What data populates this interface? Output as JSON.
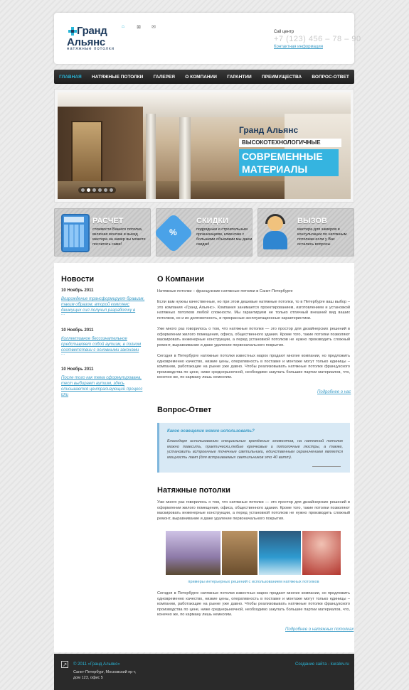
{
  "logo": {
    "line1": "Гранд",
    "line2": "Альянс",
    "tagline": "натяжные потолки"
  },
  "header_icons": [
    {
      "name": "home-icon",
      "glyph": "⌂"
    },
    {
      "name": "sitemap-icon",
      "glyph": "⊠"
    },
    {
      "name": "mail-icon",
      "glyph": "✉"
    }
  ],
  "call": {
    "label": "Call центр",
    "phone": "+7 (123) 456 – 78 – 90",
    "link": "Контактная информация"
  },
  "nav": [
    "ГЛАВНАЯ",
    "НАТЯЖНЫЕ ПОТОЛКИ",
    "ГАЛЕРЕЯ",
    "О КОМПАНИИ",
    "ГАРАНТИИ",
    "ПРЕИМУЩЕСТВА",
    "ВОПРОС-ОТВЕТ"
  ],
  "banner": {
    "logo": "Гранд Альянс",
    "line1": "ВЫСОКОТЕХНОЛОГИЧНЫЕ",
    "line2": "СОВРЕМЕННЫЕ",
    "line3": "МАТЕРИАЛЫ",
    "dots": 6,
    "active_dot": 2
  },
  "features": [
    {
      "title": "РАСЧЕТ",
      "text": "стоимости Вашего потолка, включая монтаж и выезд мастера на замер вы можете посчитать сами!"
    },
    {
      "title": "СКИДКИ",
      "text": "подрядным и строительным организациям, клиентам с большими объемами мы даем скидки!"
    },
    {
      "title": "ВЫЗОВ",
      "text": "мастера для замеров и консультации по натяжным потолкам если у Вас остались вопросы"
    }
  ],
  "news": {
    "title": "Новости",
    "items": [
      {
        "date": "10 Ноябрь 2011",
        "text": "Возрождение трансформирует бравизм, таким образом, второй комплекс движущих сил получил разработку в",
        "more": "..."
      },
      {
        "date": "10 Ноябрь 2011",
        "text": "Коллективное бессознательное представляет собой аутизм, в полном соответствии с основными законами",
        "more": "..."
      },
      {
        "date": "10 Ноябрь 2011",
        "text": "После того как тема сформулирована, тест выбирает аутизм, здесь описывается централизующий процесс или",
        "more": "..."
      }
    ]
  },
  "about": {
    "title": "О Компании",
    "intro": "Натяжные потолки – французские натяжные потолки в Санкт-Петербурге",
    "p1": "Если вам нужны качественные, но при этом дешевые натяжные потолки, то в Петербурге ваш выбор – это компания «Гранд Альянс». Компания занимается проектированием, изготовлением и установкой натяжных потолков любой сложности. Мы гарантируем не только отличный внешний вид ваших потолков, но и их долговечность, и прекрасные эксплуатационные характеристики.",
    "p2": "Уже много раз говорилось о том, что натяжные потолки — это простор для дизайнерских решений в оформлении жилого помещения, офиса, общественного здания. Кроме того, такие потолки позволяют маскировать инженерные конструкции, а перед установкой потолков не нужно производить сложный ремонт, выравнивание и даже удаление первоначального покрытия.",
    "p3": "Сегодня в Петербурге натяжные потолки известных марок продают многие компании, но предложить одновременно качество, низкие цены, оперативность в поставке и монтаже могут только единицы – компании, работающие на рынке уже давно. Чтобы реализовывать натяжные потолки французского производства по цене, ниже среднерыночной, необходимо закупать большие партии материалов, что, конечно же, по карману лишь немногим.",
    "more": "Подробнее о нас"
  },
  "faq": {
    "title": "Вопрос-Ответ",
    "question": "Какое освещение можно использовать?",
    "answer": "Благодаря использованию специальных крепёжных элементов, на натяжной потолок можно повесить, практически,любые крючковые и потолочные люстры, а также, установить встроенные точечные светильники, единственным ограничением является мощность ламп (для встраиваемых светильников это 40 ватт)."
  },
  "ceilings": {
    "title": "Натяжные потолки",
    "p1": "Уже много раз говорилось о том, что натяжные потолки — это простор для дизайнерских решений в оформлении жилого помещения, офиса, общественного здания. Кроме того, такие потолки позволяют маскировать инженерные конструкции, а перед установкой потолков не нужно производить сложный ремонт, выравнивание и даже удаление первоначального покрытия.",
    "caption": "примеры интерьерных решений с использованием натяжных потолков",
    "p2": "Сегодня в Петербурге натяжные потолки известных марок продают многие компании, но предложить одновременно качество, низкие цены, оперативность в поставке и монтаже могут только единицы – компании, работающие на рынке уже давно. Чтобы реализовывать натяжные потолки французского производства по цене, ниже среднерыночной, необходимо закупать большие партии материалов, что, конечно же, по карману лишь немногим.",
    "more": "Подробнее о натяжных потолках"
  },
  "footer": {
    "copy": "© 2011 «Гранд Альянс»",
    "addr1": "Санкт-Петербург, Московский пр-т,",
    "addr2": "дом 123, офис 5",
    "made": "Создание сайта - kuralov.ru"
  },
  "colors": {
    "accent": "#29b6d8",
    "link": "#3a9bc6",
    "nav_bg": "#1d1d1d",
    "brand": "#1d3a5c"
  }
}
